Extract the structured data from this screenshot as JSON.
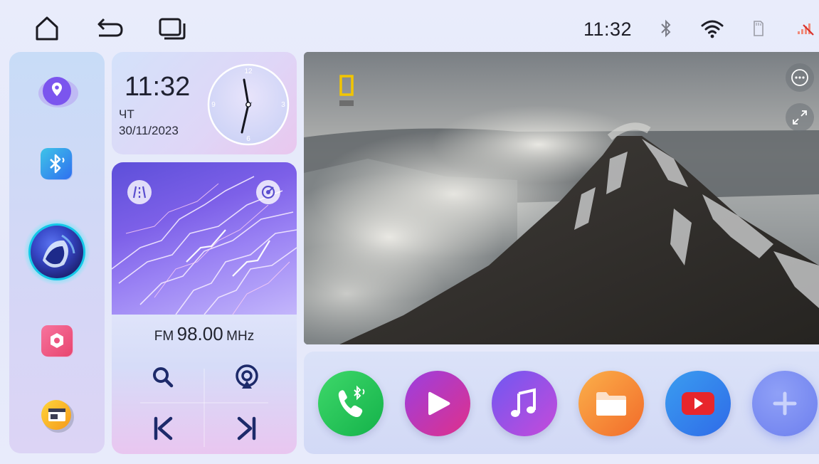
{
  "status_bar": {
    "time": "11:32",
    "icons": [
      "home-icon",
      "back-icon",
      "recent-apps-icon",
      "bluetooth-icon",
      "wifi-icon",
      "sd-card-icon",
      "no-signal-icon"
    ]
  },
  "dock": {
    "items": [
      "navigation",
      "bluetooth",
      "voice-assistant",
      "settings",
      "gallery"
    ]
  },
  "clock_widget": {
    "time": "11:32",
    "day": "ЧТ",
    "date": "30/11/2023",
    "dial_numbers": [
      "12",
      "3",
      "6",
      "9"
    ]
  },
  "radio_widget": {
    "band": "FM",
    "frequency": "98.00",
    "unit": "MHz",
    "controls": [
      "search",
      "radar",
      "previous",
      "next"
    ]
  },
  "video_panel": {
    "controls": [
      "more",
      "fullscreen"
    ]
  },
  "app_tray": {
    "apps": [
      "phone",
      "video-player",
      "music",
      "files",
      "youtube",
      "add"
    ]
  },
  "colors": {
    "accent_purple": "#7b5cf0",
    "phone_green": "#22c35a",
    "youtube_red": "#e8262b",
    "files_orange": "#f58a3a"
  }
}
